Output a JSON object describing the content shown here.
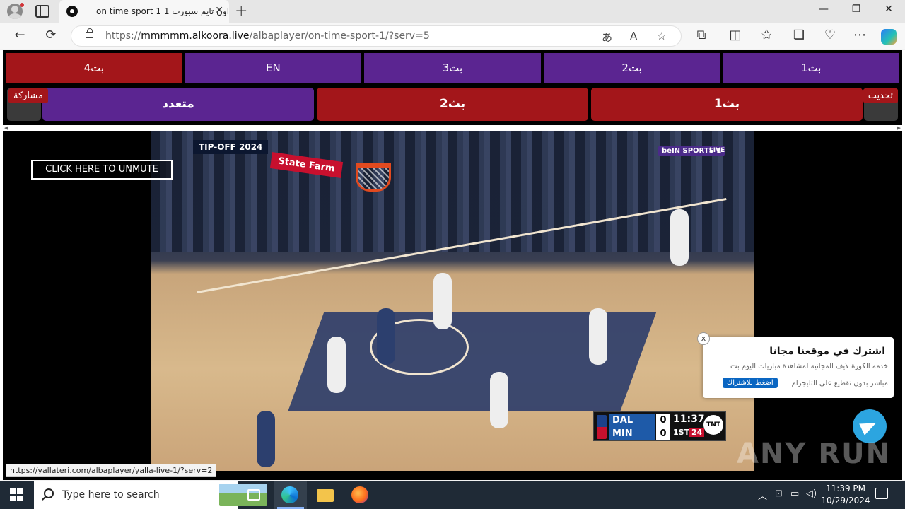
{
  "browser": {
    "tab_title": "on time sport 1 اون تايم سبورت 1",
    "tab_close": "✕",
    "new_tab": "+",
    "url_prefix": "https://",
    "url_host": "mmmmm.alkoora.live",
    "url_path": "/albaplayer/on-time-sport-1/?serv=5",
    "window_min": "—",
    "window_max": "❐",
    "window_close": "✕",
    "back": "←",
    "reload": "⟳",
    "more": "⋯"
  },
  "servers_row1": [
    {
      "label": "بث4",
      "color": "red"
    },
    {
      "label": "EN",
      "color": "purple"
    },
    {
      "label": "بث3",
      "color": "purple"
    },
    {
      "label": "بث2",
      "color": "purple"
    },
    {
      "label": "بث1",
      "color": "purple"
    }
  ],
  "servers_row2": [
    {
      "label": "متعدد",
      "color": "purple"
    },
    {
      "label": "بث2",
      "color": "red"
    },
    {
      "label": "بث1",
      "color": "red"
    }
  ],
  "share_label": "مشاركة",
  "refresh_label": "تحديث",
  "video": {
    "unmute_label": "CLICK HERE TO UNMUTE",
    "tipoff": "TIP-OFF 2024",
    "state_farm": "State Farm",
    "bein": "beIN SPORTS 1",
    "live": "LIVE"
  },
  "scoreboard": {
    "team_a": "DAL",
    "team_b": "MIN",
    "score_a": "0",
    "score_b": "0",
    "clock": "11:37",
    "period": "1ST",
    "shot_clock": "24",
    "network": "TNT"
  },
  "popup": {
    "close": "x",
    "title": "اشترك في موقعنا مجانا",
    "line1": "خدمة الكورة لايف المجانية لمشاهدة مباريات اليوم بث",
    "line2": "مباشر بدون تقطيع على التليجرام",
    "button": "اضغط للاشتراك"
  },
  "watermark": "ANY RUN",
  "status_url": "https://yallateri.com/albaplayer/yalla-live-1/?serv=2",
  "taskbar": {
    "search_placeholder": "Type here to search",
    "time": "11:39 PM",
    "date": "10/29/2024"
  },
  "colors": {
    "purple": "#5b2591",
    "red": "#a3161a"
  }
}
